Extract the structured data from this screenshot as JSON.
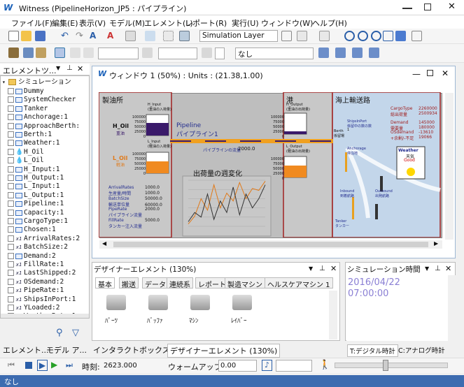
{
  "window": {
    "title": "Witness (PipelineHorizon_JP5 : パイプライン)",
    "logo": "W"
  },
  "menu": [
    "ファイル(F)",
    "編集(E)",
    "表示(V)",
    "モデル(M)",
    "エレメント(L)",
    "レポート(R)",
    "実行(U)",
    "ウィンドウ(W)",
    "ヘルプ(H)"
  ],
  "toolbar": {
    "layer_combo": "Simulation Layer",
    "name_combo": "なし"
  },
  "explorer": {
    "title": "エレメントツ...",
    "root": "シミュレーション",
    "items": [
      {
        "icon": "box",
        "label": "Dummy"
      },
      {
        "icon": "box",
        "label": "SystemChecker"
      },
      {
        "icon": "box",
        "label": "Tanker"
      },
      {
        "icon": "box",
        "label": "Anchorage:1"
      },
      {
        "icon": "box",
        "label": "ApproachBerth:"
      },
      {
        "icon": "box",
        "label": "Berth:1"
      },
      {
        "icon": "box",
        "label": "Weather:1"
      },
      {
        "icon": "drop",
        "label": "H_Oil"
      },
      {
        "icon": "drop",
        "label": "L_Oil"
      },
      {
        "icon": "box",
        "label": "H_Input:1"
      },
      {
        "icon": "box",
        "label": "H_Output:1"
      },
      {
        "icon": "box",
        "label": "L_Input:1"
      },
      {
        "icon": "box",
        "label": "L_Output:1"
      },
      {
        "icon": "box",
        "label": "Pipeline:1"
      },
      {
        "icon": "box",
        "label": "Capacity:1"
      },
      {
        "icon": "box",
        "label": "CargoType:1"
      },
      {
        "icon": "box",
        "label": "Chosen:1"
      },
      {
        "icon": "x1",
        "label": "ArrivalRates:2"
      },
      {
        "icon": "x1",
        "label": "BatchSize:2"
      },
      {
        "icon": "box",
        "label": "Demand:2"
      },
      {
        "icon": "x1",
        "label": "FillRate:1"
      },
      {
        "icon": "x1",
        "label": "LastShipped:2"
      },
      {
        "icon": "x1",
        "label": "OSdemand:2"
      },
      {
        "icon": "x1",
        "label": "PipeRate:1"
      },
      {
        "icon": "x1",
        "label": "ShipsInPort:1"
      },
      {
        "icon": "x1",
        "label": "YLoaded:2"
      },
      {
        "icon": "x1",
        "label": "WeatherRate:1"
      }
    ],
    "bottom_tabs": [
      "エレメント...",
      "モデル ア..."
    ]
  },
  "model_window": {
    "title": "ウィンドウ 1 (50%) : Units : (21.38,1.00)",
    "sections": {
      "refinery": "製油所",
      "port": "港",
      "shipping": "海上輸送路"
    },
    "tanks": {
      "h_input": {
        "name": "H_Input",
        "sub": "(重油の入荷量)",
        "ticks": [
          "100000",
          "75000",
          "50000",
          "25000",
          "0"
        ]
      },
      "l_input": {
        "name": "L_Input",
        "sub": "(軽油の入荷量)",
        "ticks": [
          "100000",
          "75000",
          "50000",
          "25000",
          "0"
        ]
      },
      "h_output": {
        "name": "H_Output",
        "sub": "(重油の出荷量)",
        "ticks": [
          "100000",
          "75000",
          "50000",
          "25000",
          "0"
        ]
      },
      "l_output": {
        "name": "L_Output",
        "sub": "(軽油の出荷量)",
        "ticks": [
          "100000",
          "75000",
          "50000",
          "25000",
          "0"
        ]
      }
    },
    "oil_labels": {
      "h_oil": "H_Oil",
      "h_oil_jp": "重油",
      "l_oil": "L_Oil",
      "l_oil_jp": "軽油"
    },
    "pipeline": {
      "label": "Pipeline",
      "label_jp": "パイプライン1",
      "flow_label": "パイプラインの流量",
      "flow_value": "2000.0"
    },
    "chart_title": "出荷量の週変化",
    "params": [
      {
        "name": "ArrivalRates",
        "jp": "生産量/時間",
        "value": "1000.0"
      },
      {
        "name": "",
        "jp": "",
        "value": "1000.0"
      },
      {
        "name": "BatchSize",
        "jp": "輸送単位量",
        "value": "50000.0"
      },
      {
        "name": "",
        "jp": "",
        "value": "60000.0"
      },
      {
        "name": "PipeRate",
        "jp": "パイプライン流量",
        "value": "2000.0"
      },
      {
        "name": "FillRate",
        "jp": "タンカー注入流量",
        "value": "5000.0"
      }
    ],
    "cargo": {
      "cargotype_label": "CargoType",
      "cargotype_jp": "総出荷量",
      "cargotype_values": [
        "2260000",
        "2500934"
      ],
      "demand_label": "Demand",
      "demand_jp": "需要量",
      "demand_values": [
        "145000",
        "180000"
      ],
      "osdemand_label": "OSdemand",
      "osdemand_jp": "+余剰/-不足",
      "osdemand_values": [
        "-13610",
        "19066"
      ]
    },
    "berth": {
      "label": "Berth",
      "jp": "係留場"
    },
    "ships_in_port": {
      "label": "ShipsInPort",
      "jp": "係留中の数の数",
      "value": "1"
    },
    "anchorage": {
      "label": "Anchorage",
      "jp": "停泊地"
    },
    "inbound": {
      "label": "Inbound",
      "jp": "到着航路"
    },
    "outbound": {
      "label": "Outbound",
      "jp": "出発航路"
    },
    "tanker": {
      "label": "Tanker",
      "jp": "タンカー"
    },
    "weather": {
      "label": "Weather",
      "jp": "天気",
      "value": "Good"
    }
  },
  "chart_data": {
    "type": "line",
    "title": "出荷量の週変化",
    "xlabel": "",
    "ylabel": "",
    "series": [
      {
        "color": "#e07a1a",
        "values": [
          5,
          22,
          60,
          35,
          90,
          40,
          72,
          55,
          95,
          60,
          82,
          78,
          98
        ]
      },
      {
        "color": "#333333",
        "values": [
          10,
          30,
          20,
          70,
          15,
          55,
          30,
          85,
          25,
          70,
          40,
          60,
          90
        ]
      }
    ],
    "ylim": [
      0,
      100
    ]
  },
  "designer": {
    "title": "デザイナーエレメント (130%)",
    "tabs": [
      "基本",
      "搬送",
      "データ",
      "連続系",
      "レポート",
      "製造マシン 1",
      "ヘルスケアマシン 1"
    ],
    "items": [
      "ﾊﾟｰﾂ",
      "ﾊﾞｯﾌｧ",
      "ﾏｼﾝ",
      "ﾚｲﾊﾞｰ"
    ]
  },
  "sim_time": {
    "title": "シミュレーション時間",
    "date": "2016/04/22",
    "time": "07:00:00",
    "tabs": [
      "T:デジタル時計",
      "C:アナログ時計"
    ]
  },
  "bottom_tabs": [
    "インタラクトボックス(I)",
    "デザイナーエレメント (130%)"
  ],
  "runbar": {
    "time_label": "時刻:",
    "time_value": "2623.000",
    "warmup_label": "ウォームアップ:",
    "warmup_value": "0.00"
  },
  "status": {
    "text": "なし"
  }
}
